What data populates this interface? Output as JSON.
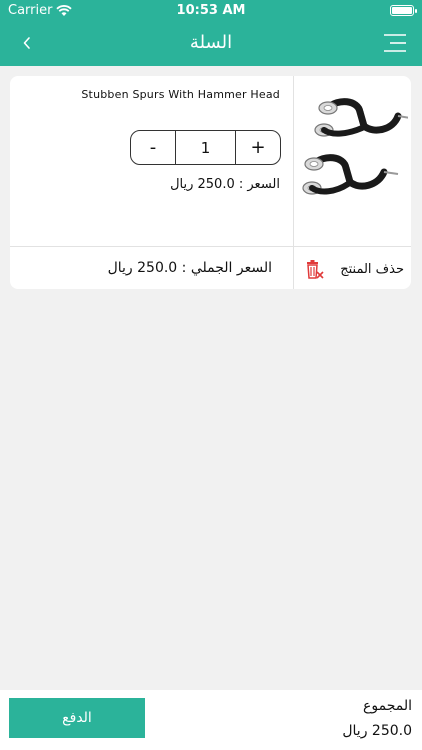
{
  "status": {
    "carrier": "Carrier",
    "time": "10:53 AM"
  },
  "nav": {
    "title": "السلة"
  },
  "cart": {
    "item": {
      "name": "Stubben Spurs With Hammer Head",
      "minus": "-",
      "plus": "+",
      "quantity": "1",
      "price": "السعر : 250.0 ريال",
      "total": "السعر الجملي : 250.0 ريال",
      "delete_label": "حذف المنتج"
    }
  },
  "footer": {
    "pay_label": "الدفع",
    "sum_label": "المجموع",
    "sum_value": "250.0 ريال"
  },
  "colors": {
    "accent": "#2bb39a",
    "delete_icon": "#e03a3a"
  },
  "icons": {
    "back": "chevron-left",
    "menu": "hamburger",
    "delete": "trash-x"
  }
}
